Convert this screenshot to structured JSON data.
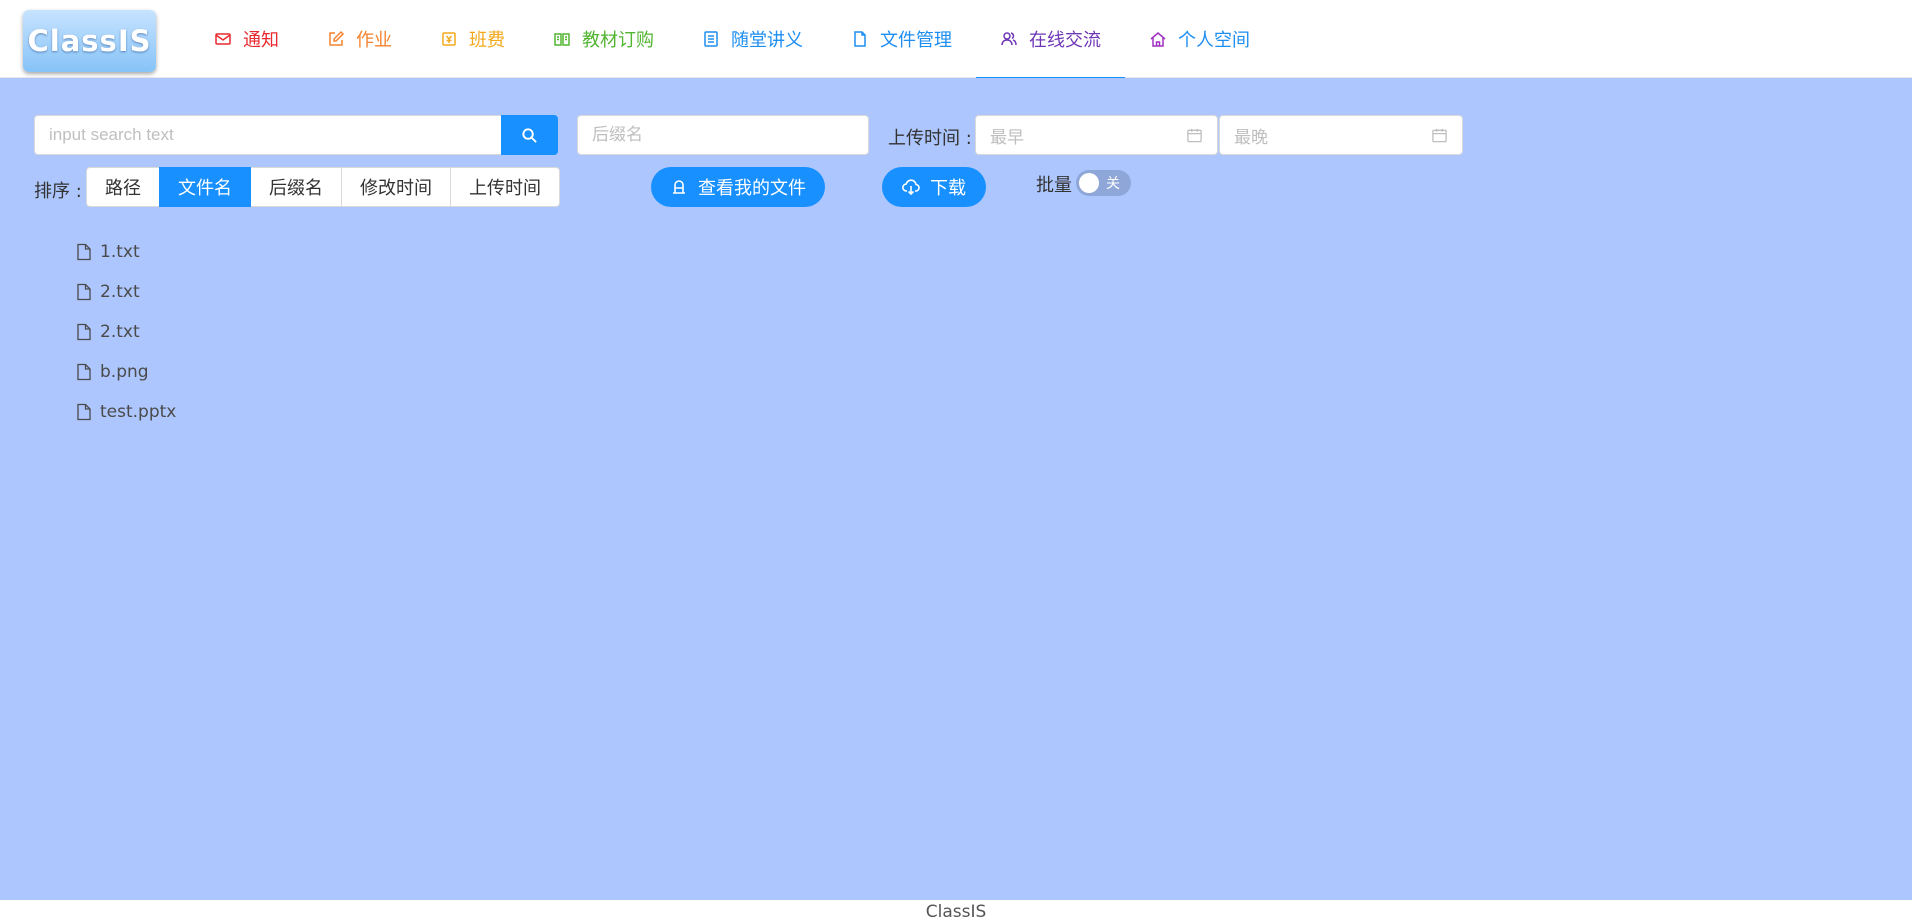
{
  "app": {
    "logo_text": "ClassIS"
  },
  "nav": [
    {
      "key": "notice",
      "label": "通知",
      "icon": "mail-icon",
      "color": "#e8292f"
    },
    {
      "key": "homework",
      "label": "作业",
      "icon": "edit-icon",
      "color": "#f5832f"
    },
    {
      "key": "fees",
      "label": "班费",
      "icon": "money-icon",
      "color": "#f4a91c"
    },
    {
      "key": "textbook",
      "label": "教材订购",
      "icon": "book-icon",
      "color": "#52b532"
    },
    {
      "key": "handout",
      "label": "随堂讲义",
      "icon": "list-icon",
      "color": "#1f8ef1"
    },
    {
      "key": "files",
      "label": "文件管理",
      "icon": "file-icon",
      "color": "#1f8ef1"
    },
    {
      "key": "chat",
      "label": "在线交流",
      "icon": "team-icon",
      "color": "#6e35b7",
      "active": true
    },
    {
      "key": "profile",
      "label": "个人空间",
      "icon": "home-icon",
      "color": "#a02fc2"
    }
  ],
  "toolbar": {
    "search_placeholder": "input search text",
    "suffix_placeholder": "后缀名",
    "upload_time_label": "上传时间 :",
    "date_earliest_placeholder": "最早",
    "date_latest_placeholder": "最晚",
    "sort_label": "排序 :",
    "sort_options": [
      "路径",
      "文件名",
      "后缀名",
      "修改时间",
      "上传时间"
    ],
    "sort_selected": "文件名",
    "my_files_label": "查看我的文件",
    "download_label": "下载",
    "batch_label": "批量",
    "batch_toggle_text": "关",
    "batch_enabled": false
  },
  "files": [
    "1.txt",
    "2.txt",
    "2.txt",
    "b.png",
    "test.pptx"
  ],
  "footer": {
    "text": "ClassIS"
  },
  "colors": {
    "primary": "#1890ff",
    "main_bg": "#adc6fd"
  }
}
